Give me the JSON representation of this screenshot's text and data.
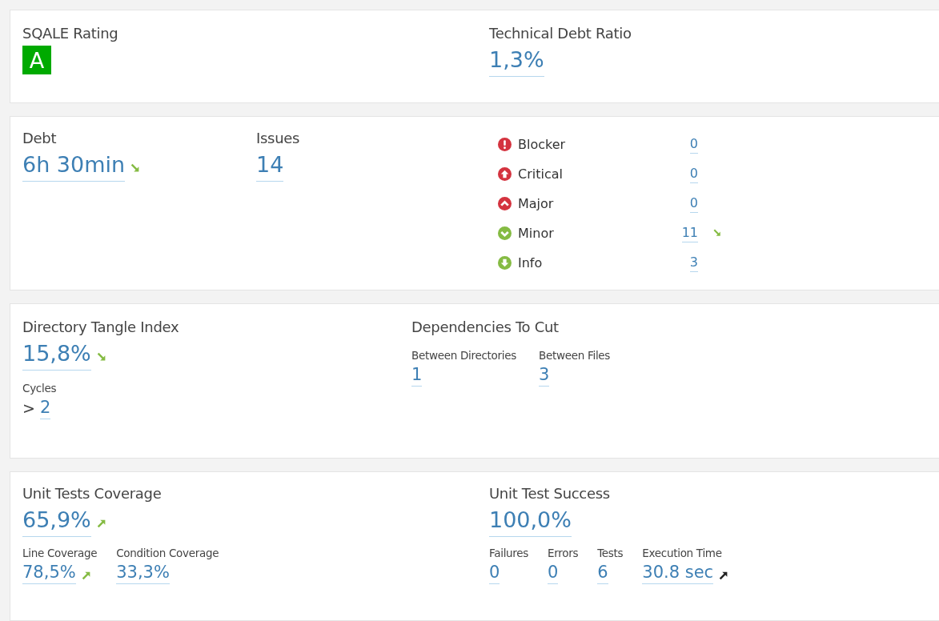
{
  "sqale": {
    "label": "SQALE Rating",
    "rating": "A"
  },
  "debt_ratio": {
    "label": "Technical Debt Ratio",
    "value": "1,3%"
  },
  "debt": {
    "label": "Debt",
    "value": "6h 30min",
    "trend": {
      "kind": "down",
      "color": "#85bb43"
    }
  },
  "issues": {
    "label": "Issues",
    "value": "14"
  },
  "severities": [
    {
      "kind": "blocker",
      "label": "Blocker",
      "count": "0"
    },
    {
      "kind": "critical",
      "label": "Critical",
      "count": "0"
    },
    {
      "kind": "major",
      "label": "Major",
      "count": "0"
    },
    {
      "kind": "minor",
      "label": "Minor",
      "count": "11",
      "trend": {
        "kind": "down",
        "color": "#85bb43"
      }
    },
    {
      "kind": "info",
      "label": "Info",
      "count": "3"
    }
  ],
  "tangle": {
    "label": "Directory Tangle Index",
    "value": "15,8%",
    "trend": {
      "kind": "down",
      "color": "#85bb43"
    },
    "cycles": {
      "label": "Cycles",
      "prefix": ">",
      "value": "2"
    }
  },
  "dependencies": {
    "label": "Dependencies To Cut",
    "items": [
      {
        "label": "Between Directories",
        "value": "1"
      },
      {
        "label": "Between Files",
        "value": "3"
      }
    ]
  },
  "coverage": {
    "label": "Unit Tests Coverage",
    "value": "65,9%",
    "trend": {
      "kind": "up",
      "color": "#85bb43"
    },
    "items": [
      {
        "label": "Line Coverage",
        "value": "78,5%",
        "trend": {
          "kind": "up",
          "color": "#85bb43"
        }
      },
      {
        "label": "Condition Coverage",
        "value": "33,3%"
      }
    ]
  },
  "success": {
    "label": "Unit Test Success",
    "value": "100,0%",
    "items": [
      {
        "label": "Failures",
        "value": "0"
      },
      {
        "label": "Errors",
        "value": "0"
      },
      {
        "label": "Tests",
        "value": "6"
      },
      {
        "label": "Execution Time",
        "value": "30.8 sec",
        "trend": {
          "kind": "up",
          "color": "#222222"
        }
      }
    ]
  }
}
